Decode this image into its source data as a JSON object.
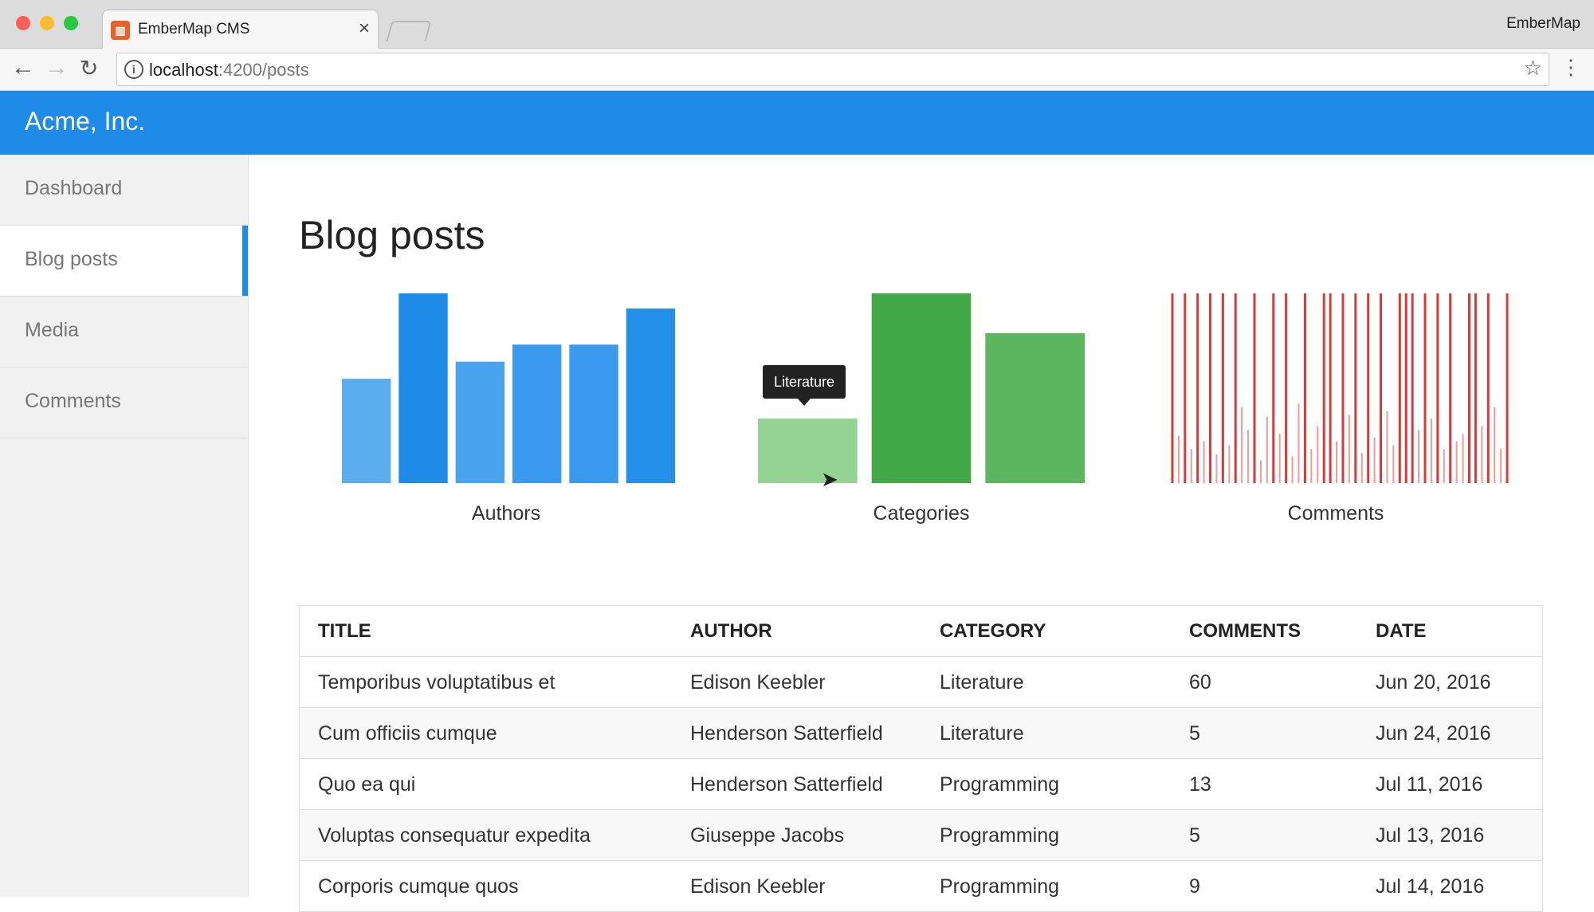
{
  "browser": {
    "tab_title": "EmberMap CMS",
    "profile": "EmberMap",
    "url_host": "localhost",
    "url_path": ":4200/posts"
  },
  "app": {
    "brand": "Acme, Inc."
  },
  "sidebar": {
    "items": [
      {
        "label": "Dashboard",
        "active": false
      },
      {
        "label": "Blog posts",
        "active": true
      },
      {
        "label": "Media",
        "active": false
      },
      {
        "label": "Comments",
        "active": false
      }
    ]
  },
  "main": {
    "title": "Blog posts"
  },
  "charts": {
    "authors_label": "Authors",
    "categories_label": "Categories",
    "comments_label": "Comments",
    "tooltip": "Literature"
  },
  "chart_data": [
    {
      "type": "bar",
      "title": "Authors",
      "values": [
        55,
        100,
        64,
        73,
        73,
        92
      ],
      "colors": [
        "#5aaef0",
        "#1e8be9",
        "#4aa3ee",
        "#3a9aed",
        "#3a9aed",
        "#2590ea"
      ]
    },
    {
      "type": "bar",
      "title": "Categories",
      "values": [
        34,
        100,
        79
      ],
      "colors": [
        "#94d394",
        "#43a848",
        "#5bb65f"
      ],
      "highlighted": "Literature"
    },
    {
      "type": "bar",
      "title": "Comments",
      "values": [
        100,
        25,
        100,
        18,
        100,
        22,
        100,
        15,
        100,
        20,
        100,
        40,
        28,
        100,
        12,
        35,
        100,
        26,
        100,
        14,
        42,
        100,
        18,
        30,
        100,
        100,
        22,
        100,
        36,
        100,
        16,
        100,
        24,
        100,
        38,
        20,
        100,
        100,
        100,
        28,
        100,
        34,
        100,
        18,
        100,
        22,
        26,
        100,
        100,
        30,
        100,
        40,
        18,
        100
      ],
      "colors": [
        "#d83a3a",
        "#f09a9a"
      ]
    }
  ],
  "table": {
    "headers": [
      "TITLE",
      "AUTHOR",
      "CATEGORY",
      "COMMENTS",
      "DATE"
    ],
    "rows": [
      [
        "Temporibus voluptatibus et",
        "Edison Keebler",
        "Literature",
        "60",
        "Jun 20, 2016"
      ],
      [
        "Cum officiis cumque",
        "Henderson Satterfield",
        "Literature",
        "5",
        "Jun 24, 2016"
      ],
      [
        "Quo ea qui",
        "Henderson Satterfield",
        "Programming",
        "13",
        "Jul 11, 2016"
      ],
      [
        "Voluptas consequatur expedita",
        "Giuseppe Jacobs",
        "Programming",
        "5",
        "Jul 13, 2016"
      ],
      [
        "Corporis cumque quos",
        "Edison Keebler",
        "Programming",
        "9",
        "Jul 14, 2016"
      ]
    ]
  }
}
